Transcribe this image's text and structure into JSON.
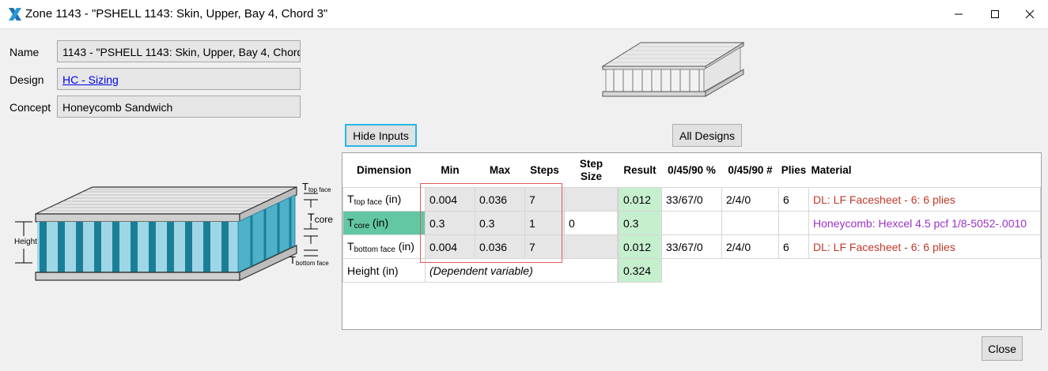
{
  "window": {
    "title": "Zone 1143 - \"PSHELL 1143: Skin, Upper, Bay 4, Chord 3\"",
    "app_icon": "x-logo-icon",
    "controls": [
      "minimize-icon",
      "maximize-icon",
      "close-icon"
    ]
  },
  "form": {
    "name_label": "Name",
    "name_value": "1143 - \"PSHELL 1143: Skin, Upper, Bay 4, Chord 3\"",
    "design_label": "Design",
    "design_value": "HC - Sizing",
    "concept_label": "Concept",
    "concept_value": "Honeycomb Sandwich"
  },
  "buttons": {
    "hide_inputs": "Hide Inputs",
    "all_designs": "All Designs",
    "close": "Close"
  },
  "diagram": {
    "height_label": "Height",
    "t_letter": "T",
    "top_face_sub": "top face",
    "core_sub": "core",
    "bottom_face_sub": "bottom face"
  },
  "table": {
    "headers": {
      "dimension": "Dimension",
      "min": "Min",
      "max": "Max",
      "steps": "Steps",
      "step_size_1": "Step",
      "step_size_2": "Size",
      "result": "Result",
      "pct": "0/45/90 %",
      "num": "0/45/90 #",
      "plies": "Plies",
      "material": "Material"
    },
    "rows": [
      {
        "t": "T",
        "sub": "top face",
        "unit": " (in)",
        "min": "0.004",
        "max": "0.036",
        "steps": "7",
        "step_size": "",
        "result": "0.012",
        "pct": "33/67/0",
        "num": "2/4/0",
        "plies": "6",
        "material": "DL: LF Facesheet - 6: 6 plies"
      },
      {
        "t": "T",
        "sub": "core",
        "unit": " (in)",
        "min": "0.3",
        "max": "0.3",
        "steps": "1",
        "step_size": "0",
        "result": "0.3",
        "pct": "",
        "num": "",
        "plies": "",
        "material": "Honeycomb: Hexcel 4.5 pcf 1/8-5052-.0010"
      },
      {
        "t": "T",
        "sub": "bottom face",
        "unit": " (in)",
        "min": "0.004",
        "max": "0.036",
        "steps": "7",
        "step_size": "",
        "result": "0.012",
        "pct": "33/67/0",
        "num": "2/4/0",
        "plies": "6",
        "material": "DL: LF Facesheet - 6: 6 plies"
      }
    ],
    "height_row": {
      "label": "Height (in)",
      "note": "(Dependent variable)",
      "result": "0.324"
    }
  },
  "colors": {
    "input_cell": "#e6e6e6",
    "result_cell": "#c6efce",
    "core_cell": "#63c7a3",
    "material_facesheet": "#c0392b",
    "material_honeycomb": "#9b30c9",
    "highlight_box": "#e15a5a",
    "focus_button": "#27b7e6",
    "honeycomb_teal": "#1a7f96"
  }
}
